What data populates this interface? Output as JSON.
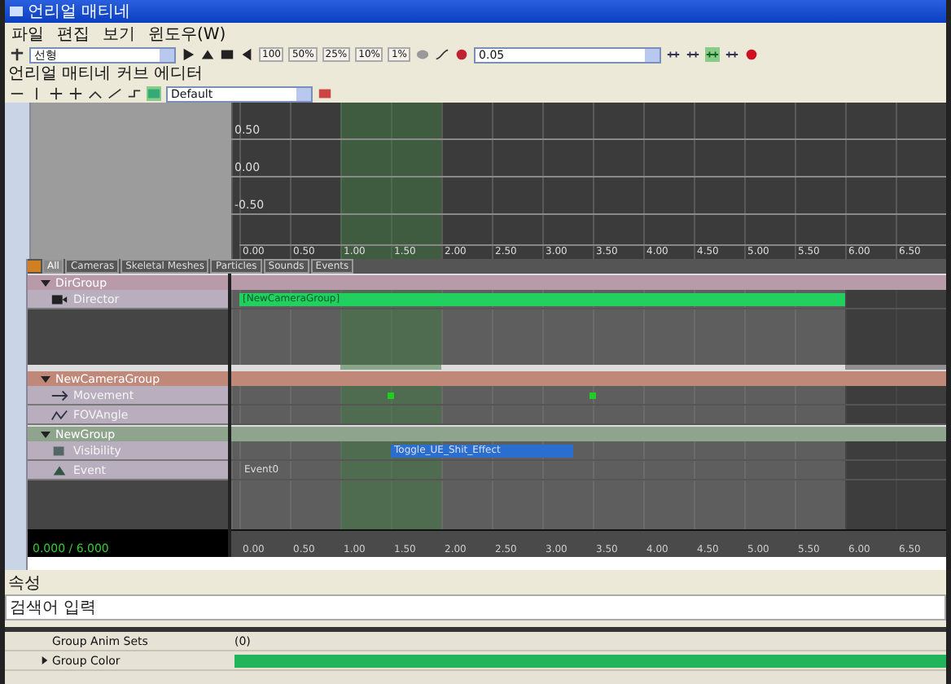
{
  "window": {
    "title": "언리얼 매티네"
  },
  "menu": [
    "파일",
    "편집",
    "보기",
    "윈도우(W)"
  ],
  "toolbar": {
    "interp_mode": "선형",
    "speeds": [
      "100",
      "50%",
      "25%",
      "10%",
      "1%"
    ],
    "snap_value": "0.05"
  },
  "curve_editor": {
    "title": "언리얼 매티네 커브 에디터",
    "preset": "Default",
    "y_labels": [
      "0.50",
      "0.00",
      "-0.50"
    ],
    "x_ticks": [
      "0.00",
      "0.50",
      "1.00",
      "1.50",
      "2.00",
      "2.50",
      "3.00",
      "3.50",
      "4.00",
      "4.50",
      "5.00",
      "5.50",
      "6.00",
      "6.50"
    ]
  },
  "tabs": [
    {
      "label": "All",
      "selected": true
    },
    {
      "label": "Cameras",
      "selected": false
    },
    {
      "label": "Skeletal Meshes",
      "selected": false
    },
    {
      "label": "Particles",
      "selected": false
    },
    {
      "label": "Sounds",
      "selected": false
    },
    {
      "label": "Events",
      "selected": false
    }
  ],
  "groups": [
    {
      "name": "DirGroup",
      "color": "#b89aa8",
      "tracks": [
        {
          "name": "Director",
          "kind": "director",
          "bar_label": "[NewCameraGroup]"
        }
      ]
    },
    {
      "name": "NewCameraGroup",
      "color": "#c08878",
      "tracks": [
        {
          "name": "Movement",
          "kind": "movement"
        },
        {
          "name": "FOVAngle",
          "kind": "float"
        }
      ]
    },
    {
      "name": "NewGroup",
      "color": "#8fa48c",
      "tracks": [
        {
          "name": "Visibility",
          "kind": "toggle",
          "bar_label": "Toggle_UE_Shit_Effect"
        },
        {
          "name": "Event",
          "kind": "event",
          "bar_label": "Event0"
        }
      ]
    }
  ],
  "ruler": {
    "time": "0.000 / 6.000",
    "ticks": [
      "0.00",
      "0.50",
      "1.00",
      "1.50",
      "2.00",
      "2.50",
      "3.00",
      "3.50",
      "4.00",
      "4.50",
      "5.00",
      "5.50",
      "6.00",
      "6.50"
    ]
  },
  "properties": {
    "title": "속성",
    "search": {
      "placeholder": "검색어 입력"
    },
    "rows": [
      {
        "name": "Group Anim Sets",
        "kind": "text",
        "value": "(0)"
      },
      {
        "name": "Group Color",
        "kind": "color",
        "expanded": false,
        "color": "#22b45a"
      }
    ]
  }
}
